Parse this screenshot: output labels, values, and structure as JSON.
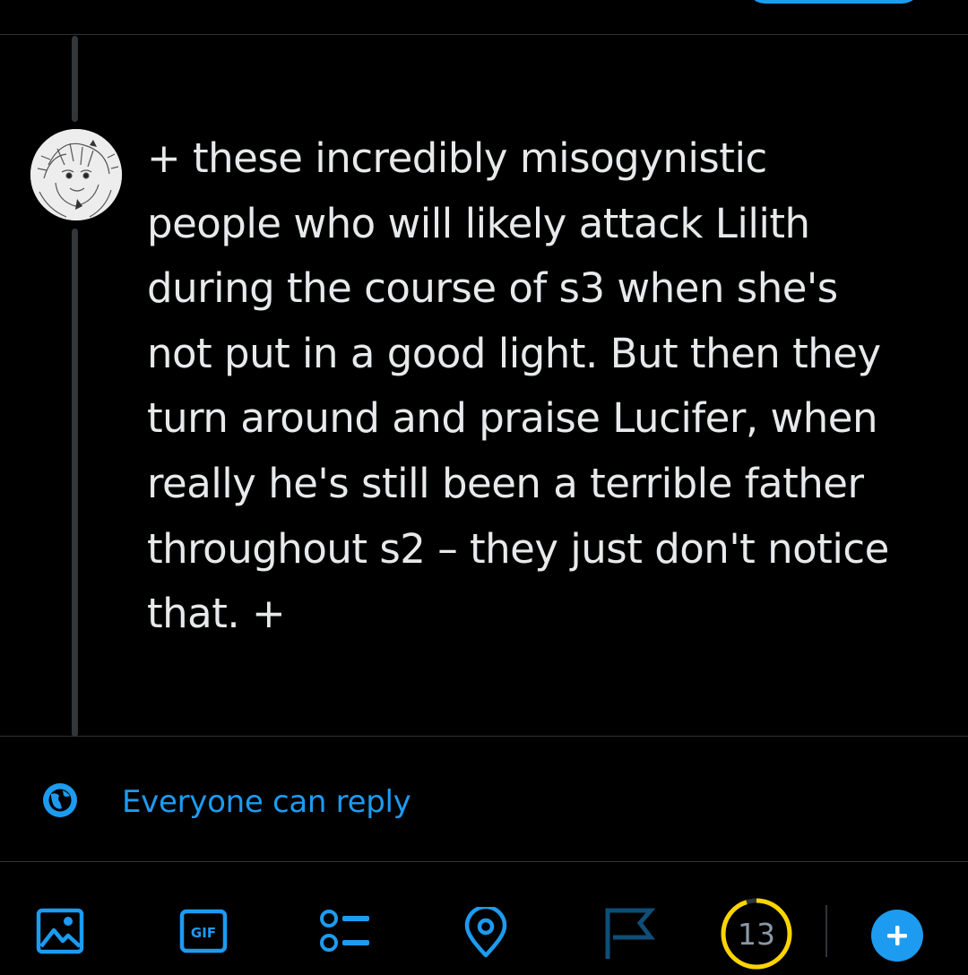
{
  "tweet": {
    "text": "+ these incredibly misogynistic\npeople who will likely attack Lilith\nduring the course of s3 when she's\nnot put in a good light. But then they\nturn around and praise Lucifer, when\nreally he's still been a terrible father\nthroughout s2 – they just don't notice\nthat. +"
  },
  "reply_settings": {
    "label": "Everyone can reply",
    "icon": "globe-icon"
  },
  "toolbar": {
    "icons": [
      "image-icon",
      "gif-icon",
      "poll-icon",
      "location-icon",
      "flag-icon",
      "add-icon"
    ],
    "gif_label": "GIF",
    "char_counter": "13",
    "char_counter_progress": 0.95
  },
  "colors": {
    "accent": "#1d9bf0",
    "counter_warning": "#ffd400",
    "background": "#000000",
    "text": "#e7e9ea"
  }
}
